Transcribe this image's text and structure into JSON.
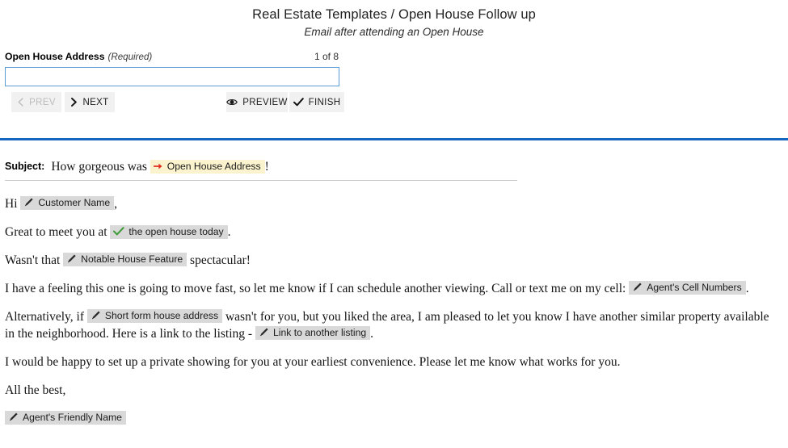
{
  "header": {
    "title": "Real Estate Templates / Open House Follow up",
    "subtitle": "Email after attending an Open House"
  },
  "wizard": {
    "field_label": "Open House Address",
    "required_note": "(Required)",
    "counter": "1 of 8",
    "input_value": "",
    "input_placeholder": "",
    "buttons": {
      "prev": "PREV",
      "next": "NEXT",
      "preview": "PREVIEW",
      "finish": "FINISH"
    },
    "icons": {
      "prev": "chevron-left-icon",
      "next": "chevron-right-icon",
      "preview": "eye-icon",
      "finish": "check-icon"
    },
    "prev_disabled": true
  },
  "colors": {
    "rule": "#1665C1",
    "input_border": "#5B9BD5",
    "button_bg": "#F1F1F1",
    "token_grey": "#D9D9D9",
    "token_yellow": "#FBF3CE",
    "arrow_red": "#E03020",
    "check_green": "#3D9B35",
    "disabled_text": "#BCBCBC"
  },
  "email": {
    "subject_label": "Subject:",
    "subject": {
      "before": "How gorgeous was ",
      "token": "Open House Address",
      "token_icon": "arrow-right-icon",
      "after": "!"
    },
    "greeting": {
      "before": "Hi ",
      "token": "Customer Name",
      "token_icon": "pencil-icon",
      "after": ","
    },
    "line_meet": {
      "before": "Great to meet you at ",
      "token": "the open house today",
      "token_icon": "check-icon",
      "after": "."
    },
    "line_feature": {
      "before": "Wasn't that ",
      "token": "Notable House Feature",
      "token_icon": "pencil-icon",
      "after": " spectacular!"
    },
    "line_feeling": {
      "before": "I have a feeling this one is going to move fast, so let me know if I can schedule another viewing. Call or text me on my cell: ",
      "token": "Agent's Cell Numbers",
      "token_icon": "pencil-icon",
      "after": "."
    },
    "line_alternatively": {
      "before": "Alternatively, if ",
      "token1": "Short form house address",
      "token1_icon": "pencil-icon",
      "middle": " wasn't for you, but you liked the area, I am pleased to let you know I have another similar property available in the neighborhood. Here is a link to the listing - ",
      "token2": "Link to another listing",
      "token2_icon": "pencil-icon",
      "after": "."
    },
    "line_showing": "I would be happy to set up a private showing for you at your earliest convenience.  Please let me know what works for you.",
    "line_closing": "All the best,",
    "signature": {
      "token": "Agent's Friendly Name",
      "token_icon": "pencil-icon"
    }
  }
}
